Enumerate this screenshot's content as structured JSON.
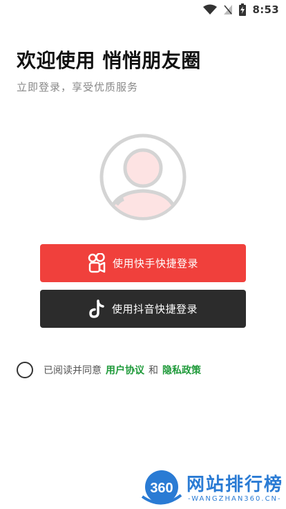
{
  "status_bar": {
    "time": "8:53",
    "icons": [
      "wifi-icon",
      "signal-off-icon",
      "battery-charging-icon"
    ]
  },
  "welcome": {
    "title": "欢迎使用 悄悄朋友圈",
    "subtitle": "立即登录，享受优质服务"
  },
  "avatar": {
    "icon": "user-avatar-icon"
  },
  "login": {
    "kuaishou_label": "使用快手快捷登录",
    "douyin_label": "使用抖音快捷登录",
    "kuaishou_color": "#f0403c",
    "douyin_color": "#2c2c2c"
  },
  "agreement": {
    "prefix": "已阅读并同意",
    "user_agreement": "用户协议",
    "and": "和",
    "privacy_policy": "隐私政策",
    "link_color": "#1f9a3a"
  },
  "watermark": {
    "logo_text": "360",
    "name": "网站排行榜",
    "url": "-WANGZHAN360.CN-"
  }
}
